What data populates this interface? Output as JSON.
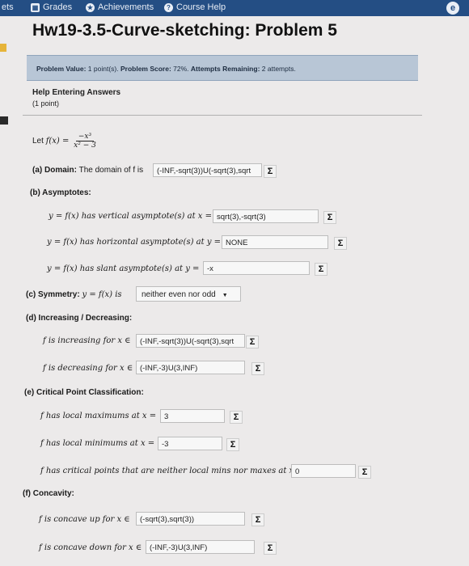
{
  "nav": {
    "left_fragment": "ets",
    "grades_label": "Grades",
    "achievements_label": "Achievements",
    "course_help_label": "Course Help"
  },
  "title": "Hw19-3.5-Curve-sketching: Problem 5",
  "info": {
    "problem_value_label": "Problem Value:",
    "problem_value": "1 point(s).",
    "problem_score_label": "Problem Score:",
    "problem_score": "72%.",
    "attempts_label": "Attempts Remaining:",
    "attempts": "2 attempts."
  },
  "help": {
    "title": "Help Entering Answers",
    "points": "(1 point)"
  },
  "problem": {
    "let_text": "Let",
    "func": "f(x) =",
    "numerator": "−x³",
    "denominator": "x² − 3",
    "domain_label": "(a) Domain:",
    "domain_text": "The domain of f is",
    "domain_value": "(-INF,-sqrt(3))U(-sqrt(3),sqrt",
    "asymptotes_label": "(b) Asymptotes:",
    "vert_text": "y = f(x) has vertical asymptote(s) at x =",
    "vert_value": "sqrt(3),-sqrt(3)",
    "horiz_text": "y = f(x) has horizontal asymptote(s) at y =",
    "horiz_value": "NONE",
    "slant_text": "y = f(x) has slant asymptote(s) at y =",
    "slant_value": "-x",
    "symmetry_label": "(c) Symmetry:",
    "symmetry_text": "y = f(x) is",
    "symmetry_value": "neither even nor odd",
    "incdec_label": "(d) Increasing / Decreasing:",
    "inc_text": "f is increasing for x ∈",
    "inc_value": "(-INF,-sqrt(3))U(-sqrt(3),sqrt",
    "dec_text": "f is decreasing for x ∈",
    "dec_value": "(-INF,-3)U(3,INF)",
    "critical_label": "(e) Critical Point Classification:",
    "max_text": "f has local maximums at x =",
    "max_value": "3",
    "min_text": "f has local minimums at x =",
    "min_value": "-3",
    "neither_text": "f has critical points that are neither local mins nor maxes at x =",
    "neither_value": "0",
    "concavity_label": "(f) Concavity:",
    "up_text": "f is concave up for x ∈",
    "up_value": "(-sqrt(3),sqrt(3))",
    "down_text": "f is concave down for x ∈",
    "down_value": "(-INF,-3)U(3,INF)"
  },
  "sigma_symbol": "Σ",
  "colors": {
    "nav_bg": "#244e84",
    "info_bg": "#b8c6d6"
  }
}
